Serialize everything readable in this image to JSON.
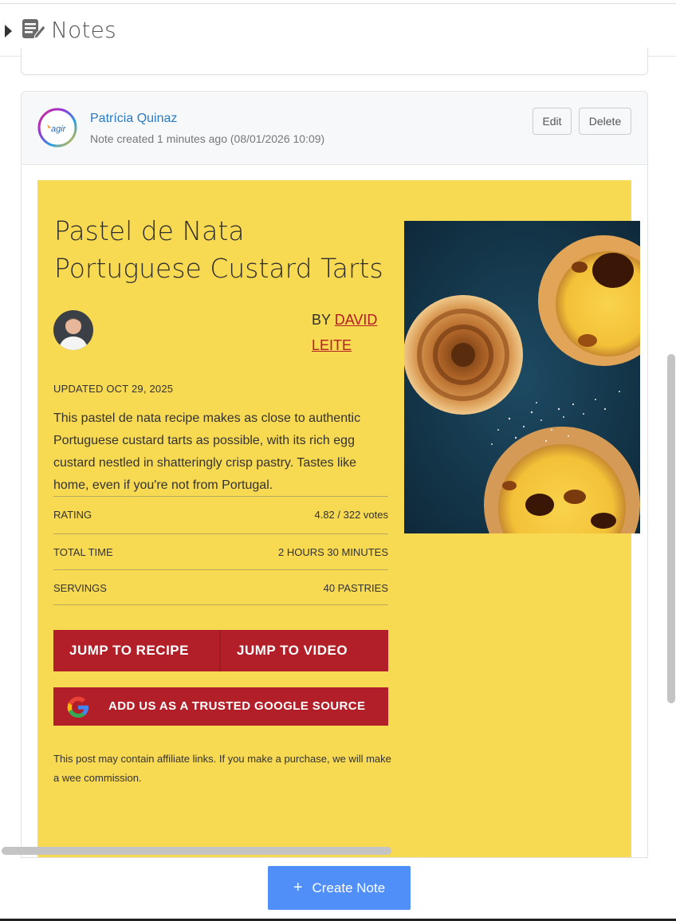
{
  "header": {
    "title": "Notes",
    "caret_icon": "caret-right-icon",
    "notes_icon": "notes-edit-icon"
  },
  "note": {
    "author": "Patrícia Quinaz",
    "meta": "Note created 1 minutes ago (08/01/2026 10:09)",
    "avatar_text": "agir",
    "edit_label": "Edit",
    "delete_label": "Delete"
  },
  "recipe": {
    "title_line1": "Pastel de Nata",
    "title_line2": "Portuguese Custard Tarts",
    "by_prefix": "BY",
    "by_first": "DAVID",
    "by_last": "LEITE",
    "updated": "UPDATED OCT 29, 2025",
    "description": "This pastel de nata recipe makes as close to authentic Portuguese custard tarts as possible, with its rich egg custard nestled in shatteringly crisp pastry. Tastes like home, even if you're not from Portugal.",
    "rows": [
      {
        "label": "RATING",
        "value": "4.82 / 322 votes"
      },
      {
        "label": "TOTAL TIME",
        "value": "2 HOURS 30 MINUTES"
      },
      {
        "label": "SERVINGS",
        "value": "40 PASTRIES"
      }
    ],
    "jump_recipe": "JUMP TO RECIPE",
    "jump_video": "JUMP TO VIDEO",
    "google_label": "ADD US AS A TRUSTED GOOGLE SOURCE",
    "disclaimer": "This post may contain affiliate links. If you make a purchase, we will make a wee commission."
  },
  "footer": {
    "create_label": "Create Note"
  },
  "colors": {
    "recipe_bg": "#f8d952",
    "accent_red": "#b21f28",
    "author_blue": "#2a7ac0",
    "create_button": "#4f8ff7"
  }
}
